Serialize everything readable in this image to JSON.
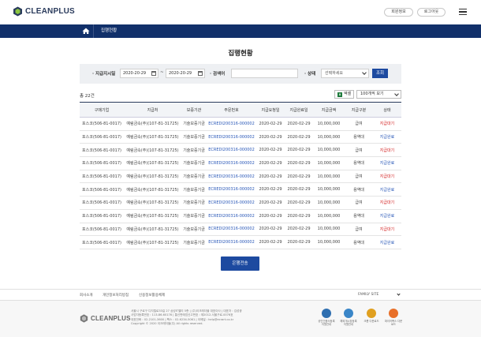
{
  "header": {
    "brand": "CLEANPLUS",
    "member_info": "회원정보",
    "logout": "로그아웃"
  },
  "nav": {
    "breadcrumb": "집행현황"
  },
  "page": {
    "title": "집행현황"
  },
  "search": {
    "date_label": "지급지시일",
    "date_from": "2020-20-29",
    "date_sep": "~",
    "date_to": "2020-20-29",
    "keyword_label": "검색어",
    "keyword_value": "",
    "status_label": "상태",
    "status_selected": "선택하세요",
    "search_button": "조회"
  },
  "results": {
    "total": "총 22건",
    "excel_button": "엑셀",
    "per_page": "100개씩 보기"
  },
  "table": {
    "columns": [
      "구매기업",
      "지급처",
      "보증기관",
      "주문번호",
      "지급요청일",
      "지급완료일",
      "지급금액",
      "지급구분",
      "상태"
    ],
    "rows": [
      [
        "포스코(506-81-0017)",
        "예림금속(주)(107-81-31725)",
        "기술보증기금",
        "ECREDI200316-000002",
        "2020-02-29",
        "2020-02-29",
        "10,000,000",
        "급여",
        "지급대기"
      ],
      [
        "포스코(506-81-0017)",
        "예림금속(주)(107-81-31725)",
        "기술보증기금",
        "ECREDI200316-000002",
        "2020-02-29",
        "2020-02-29",
        "10,000,000",
        "용역대",
        "지급완료"
      ],
      [
        "포스코(506-81-0017)",
        "예림금속(주)(107-81-31725)",
        "기술보증기금",
        "ECREDI200316-000002",
        "2020-02-29",
        "2020-02-29",
        "10,000,000",
        "급여",
        "지급대기"
      ],
      [
        "포스코(506-81-0017)",
        "예림금속(주)(107-81-31725)",
        "기술보증기금",
        "ECREDI200316-000002",
        "2020-02-29",
        "2020-02-29",
        "10,000,000",
        "용역대",
        "지급완료"
      ],
      [
        "포스코(506-81-0017)",
        "예림금속(주)(107-81-31725)",
        "기술보증기금",
        "ECREDI200316-000002",
        "2020-02-29",
        "2020-02-29",
        "10,000,000",
        "급여",
        "지급대기"
      ],
      [
        "포스코(506-81-0017)",
        "예림금속(주)(107-81-31725)",
        "기술보증기금",
        "ECREDI200316-000002",
        "2020-02-29",
        "2020-02-29",
        "10,000,000",
        "용역대",
        "지급완료"
      ],
      [
        "포스코(506-81-0017)",
        "예림금속(주)(107-81-31725)",
        "기술보증기금",
        "ECREDI200316-000002",
        "2020-02-29",
        "2020-02-29",
        "10,000,000",
        "급여",
        "지급대기"
      ],
      [
        "포스코(506-81-0017)",
        "예림금속(주)(107-81-31725)",
        "기술보증기금",
        "ECREDI200316-000002",
        "2020-02-29",
        "2020-02-29",
        "10,000,000",
        "용역대",
        "지급완료"
      ],
      [
        "포스코(506-81-0017)",
        "예림금속(주)(107-81-31725)",
        "기술보증기금",
        "ECREDI200316-000002",
        "2020-02-29",
        "2020-02-29",
        "10,000,000",
        "급여",
        "지급대기"
      ],
      [
        "포스코(506-81-0017)",
        "예림금속(주)(107-81-31725)",
        "기술보증기금",
        "ECREDI200316-000002",
        "2020-02-29",
        "2020-02-29",
        "10,000,000",
        "용역대",
        "지급완료"
      ]
    ],
    "status_wait": "지급대기",
    "status_colors": {
      "wait": "#d42222",
      "done": "#2a58b8"
    }
  },
  "actions": {
    "execute_button": "은행전송"
  },
  "footer": {
    "links": [
      "회사소개",
      "개인정보처리방침",
      "신용정보활용체제"
    ],
    "family_site": "FAMILY SITE",
    "brand": "CLEANPLUS",
    "address_lines": [
      "서울시 구로구 디지털로33길 27 삼성IT밸리 5층 | (주)이크레더블 대표이사 | 대표자 : 김성광",
      "사업자등록번호 : 113-86-60176 | 통신판매업신고번호 : 제2012-서울구로-0076호",
      "대표전화 : 02-2101-3600 | 팩스 : 02-6234-5061 | 이메일 : help@ecrart.co.kr",
      "Copyright © 2020 이크레더블(주) All rights reserved."
    ],
    "certs": [
      {
        "label": "공인인증서등록 지원안내",
        "icon": "certificate-icon",
        "color": "#2f6fb0"
      },
      {
        "label": "해외개시장등록 지원안내",
        "icon": "globe-icon",
        "color": "#3a86c8"
      },
      {
        "label": "크롬 다운로드",
        "icon": "chrome-icon",
        "color": "#e0a020"
      },
      {
        "label": "파이어폭스 다운로드",
        "icon": "firefox-icon",
        "color": "#e8702a"
      }
    ]
  },
  "colors": {
    "brand_navy": "#11306a",
    "primary_button": "#1d4aa0",
    "excel_green": "#1e7a3c"
  }
}
